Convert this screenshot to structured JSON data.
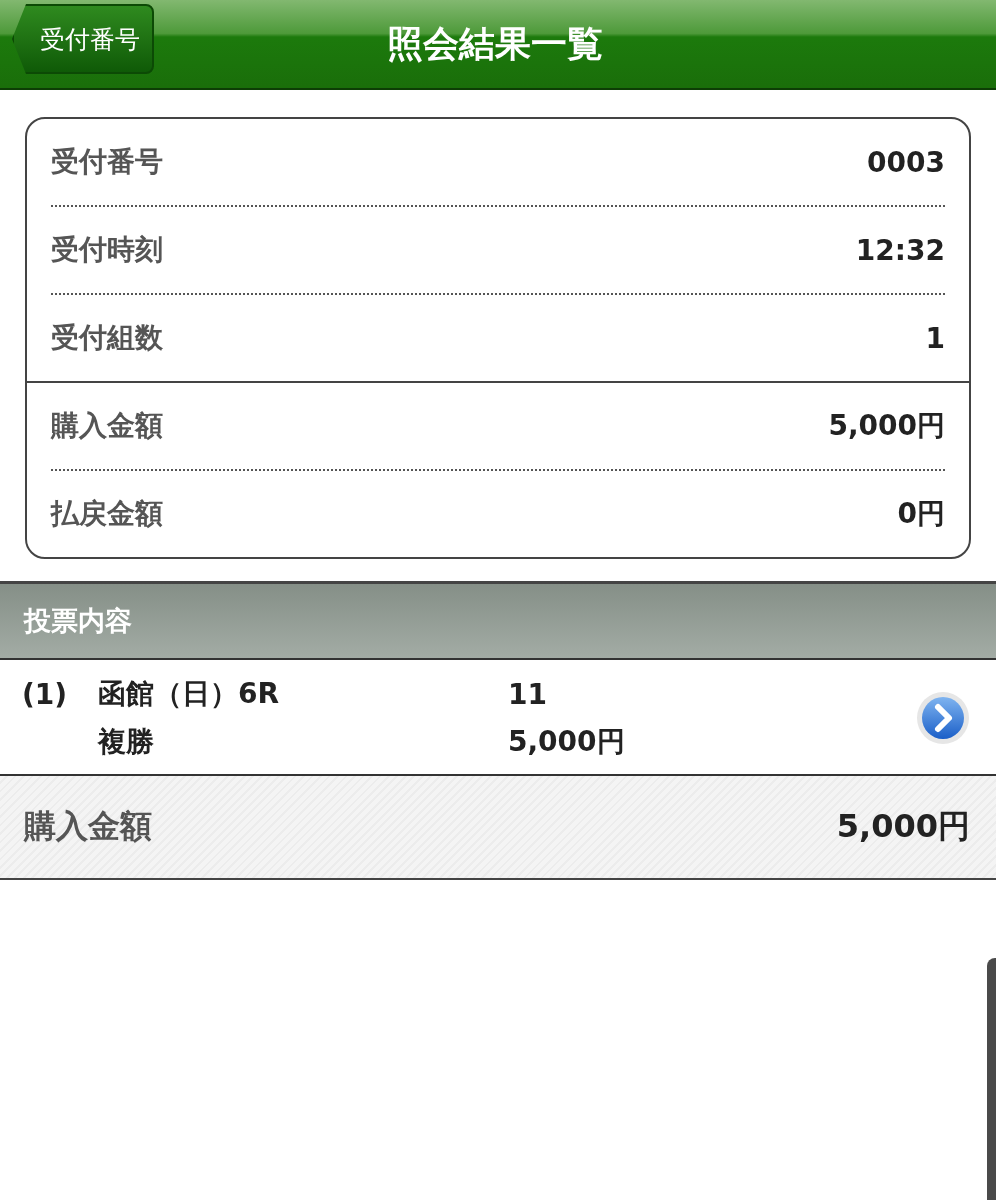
{
  "header": {
    "back_button": "受付番号",
    "title": "照会結果一覧"
  },
  "summary": {
    "groups": [
      [
        {
          "label": "受付番号",
          "value": "0003"
        },
        {
          "label": "受付時刻",
          "value": "12:32"
        },
        {
          "label": "受付組数",
          "value": "1"
        }
      ],
      [
        {
          "label": "購入金額",
          "value": "5,000円"
        },
        {
          "label": "払戻金額",
          "value": "0円"
        }
      ]
    ]
  },
  "bets": {
    "title": "投票内容",
    "items": [
      {
        "number": "(1)",
        "race": "函館（日）6R",
        "horses": "11",
        "bet_type": "複勝",
        "amount": "5,000円"
      }
    ]
  },
  "total": {
    "label": "購入金額",
    "value": "5,000円"
  }
}
